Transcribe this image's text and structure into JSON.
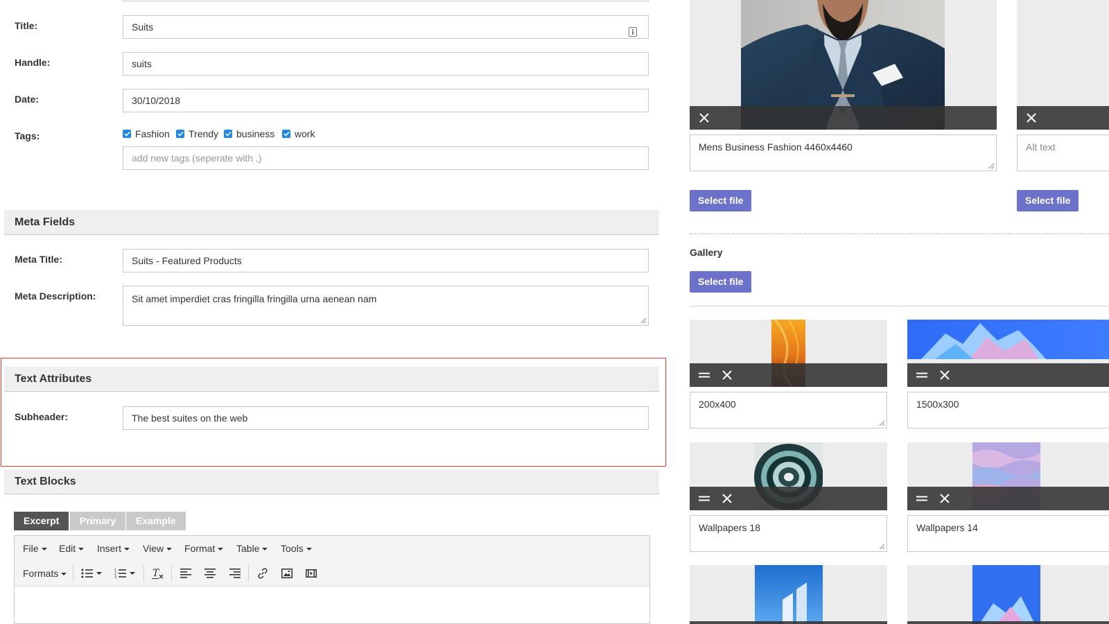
{
  "form": {
    "title_label": "Title:",
    "title_value": "Suits",
    "handle_label": "Handle:",
    "handle_value": "suits",
    "date_label": "Date:",
    "date_value": "30/10/2018",
    "tags_label": "Tags:",
    "tags": [
      "Fashion",
      "Trendy",
      "business",
      "work"
    ],
    "new_tag_placeholder": "add new tags (seperate with ,)"
  },
  "meta": {
    "header": "Meta Fields",
    "meta_title_label": "Meta Title:",
    "meta_title_value": "Suits - Featured Products",
    "meta_description_label": "Meta Description:",
    "meta_description_value": "Sit amet imperdiet cras fringilla fringilla urna aenean nam"
  },
  "text_attributes": {
    "header": "Text Attributes",
    "subheader_label": "Subheader:",
    "subheader_value": "The best suites on the web"
  },
  "text_blocks": {
    "header": "Text Blocks",
    "tabs": [
      "Excerpt",
      "Primary",
      "Example"
    ],
    "active_tab": "Excerpt",
    "menu": [
      "File",
      "Edit",
      "Insert",
      "View",
      "Format",
      "Table",
      "Tools"
    ],
    "formats_label": "Formats"
  },
  "media": {
    "main_image_caption": "Mens Business Fashion 4460x4460",
    "second_image_placeholder": "Alt text",
    "select_file_label": "Select file",
    "gallery_label": "Gallery",
    "gallery_items": [
      {
        "caption": "200x400"
      },
      {
        "caption": "1500x300"
      },
      {
        "caption": "Wallpapers 18"
      },
      {
        "caption": "Wallpapers 14"
      }
    ]
  },
  "colors": {
    "accent_button": "#6c72c9",
    "checkbox": "#1e88e5",
    "highlight_border": "#e53935",
    "active_tab": "#555555",
    "inactive_tab": "#c9c9c9"
  }
}
